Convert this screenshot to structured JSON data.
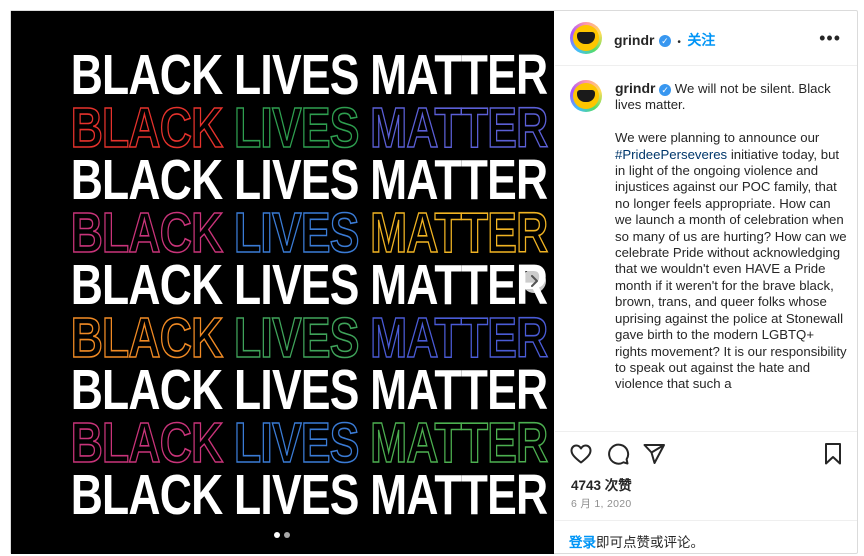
{
  "post": {
    "image_lines": [
      {
        "text": "BLACK LIVES MATTER",
        "style": "solid"
      },
      {
        "words": [
          "BLACK",
          "LIVES",
          "MATTER"
        ],
        "colors": [
          "#e5322c",
          "#2e9e4f",
          "#5b5fd6"
        ],
        "style": "outline"
      },
      {
        "text": "BLACK LIVES MATTER",
        "style": "solid"
      },
      {
        "words": [
          "BLACK",
          "LIVES",
          "MATTER"
        ],
        "colors": [
          "#c9347a",
          "#3a7bd5",
          "#f0b323"
        ],
        "style": "outline"
      },
      {
        "text": "BLACK LIVES MATTER",
        "style": "solid"
      },
      {
        "words": [
          "BLACK",
          "LIVES",
          "MATTER"
        ],
        "colors": [
          "#f08a24",
          "#3fa35a",
          "#4a5bd6"
        ],
        "style": "outline"
      },
      {
        "text": "BLACK LIVES MATTER",
        "style": "solid"
      },
      {
        "words": [
          "BLACK",
          "LIVES",
          "MATTER"
        ],
        "colors": [
          "#c9347a",
          "#3a7bd5",
          "#4caf50"
        ],
        "style": "outline"
      },
      {
        "text": "BLACK LIVES MATTER",
        "style": "solid"
      }
    ],
    "carousel_count": 2,
    "carousel_active": 0
  },
  "header": {
    "username": "grindr",
    "verified_mark": "✓",
    "separator": "•",
    "follow_label": "关注",
    "more_label": "•••"
  },
  "caption": {
    "username": "grindr",
    "intro": "We will not be silent. Black lives matter.",
    "body_before_tag": "We were planning to announce our ",
    "hashtag": "#PrideePerseveres",
    "body_after_tag": " initiative today, but in light of the ongoing violence and injustices against our POC family, that no longer feels appropriate. How can we launch a month of celebration when so many of us are hurting? How can we celebrate Pride without acknowledging that we wouldn't even HAVE a Pride month if it weren't for the brave black, brown, trans, and queer folks whose uprising against the police at Stonewall gave birth to the modern LGBTQ+ rights movement? It is our responsibility to speak out against the hate and violence that such a"
  },
  "stats": {
    "likes": "4743 次赞",
    "date": "6 月 1, 2020"
  },
  "login": {
    "link": "登录",
    "rest": "即可点赞或评论。"
  },
  "icons": {
    "like": "heart-icon",
    "comment": "comment-icon",
    "share": "paper-plane-icon",
    "save": "bookmark-icon",
    "next": "chevron-right-icon"
  }
}
